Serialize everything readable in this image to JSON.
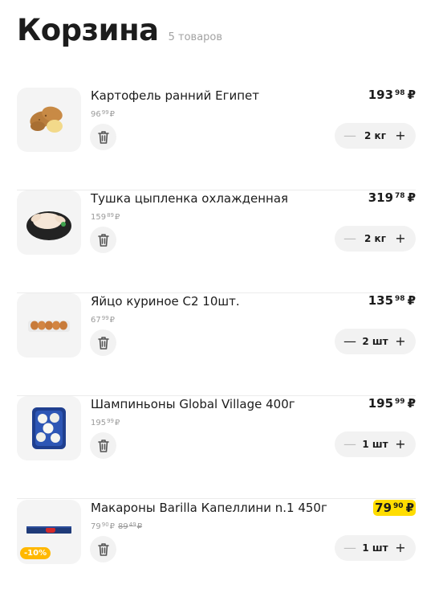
{
  "header": {
    "title": "Корзина",
    "count": "5 товаров"
  },
  "currency": "₽",
  "items": [
    {
      "name": "Картофель ранний Египет",
      "unit_price_int": "96",
      "unit_price_kop": "99",
      "price_int": "193",
      "price_kop": "98",
      "qty": "2 кг",
      "image_icon": "potato-icon"
    },
    {
      "name": "Тушка цыпленка охлажденная",
      "unit_price_int": "159",
      "unit_price_kop": "89",
      "price_int": "319",
      "price_kop": "78",
      "qty": "2 кг",
      "image_icon": "chicken-icon"
    },
    {
      "name": "Яйцо куриное С2 10шт.",
      "unit_price_int": "67",
      "unit_price_kop": "99",
      "price_int": "135",
      "price_kop": "98",
      "qty": "2 шт",
      "image_icon": "eggs-icon"
    },
    {
      "name": "Шампиньоны Global Village 400г",
      "unit_price_int": "195",
      "unit_price_kop": "99",
      "price_int": "195",
      "price_kop": "99",
      "qty": "1 шт",
      "image_icon": "mushrooms-icon"
    },
    {
      "name": "Макароны Barilla Капеллини n.1 450г",
      "unit_price_int": "79",
      "unit_price_kop": "90",
      "old_unit_price_int": "89",
      "old_unit_price_kop": "49",
      "price_int": "79",
      "price_kop": "90",
      "qty": "1 шт",
      "discount": "-10%",
      "image_icon": "pasta-icon",
      "promo_color": "#ffdd00"
    }
  ],
  "colors": {
    "discount_badge": "#ffb800",
    "promo_highlight": "#ffdd00"
  }
}
